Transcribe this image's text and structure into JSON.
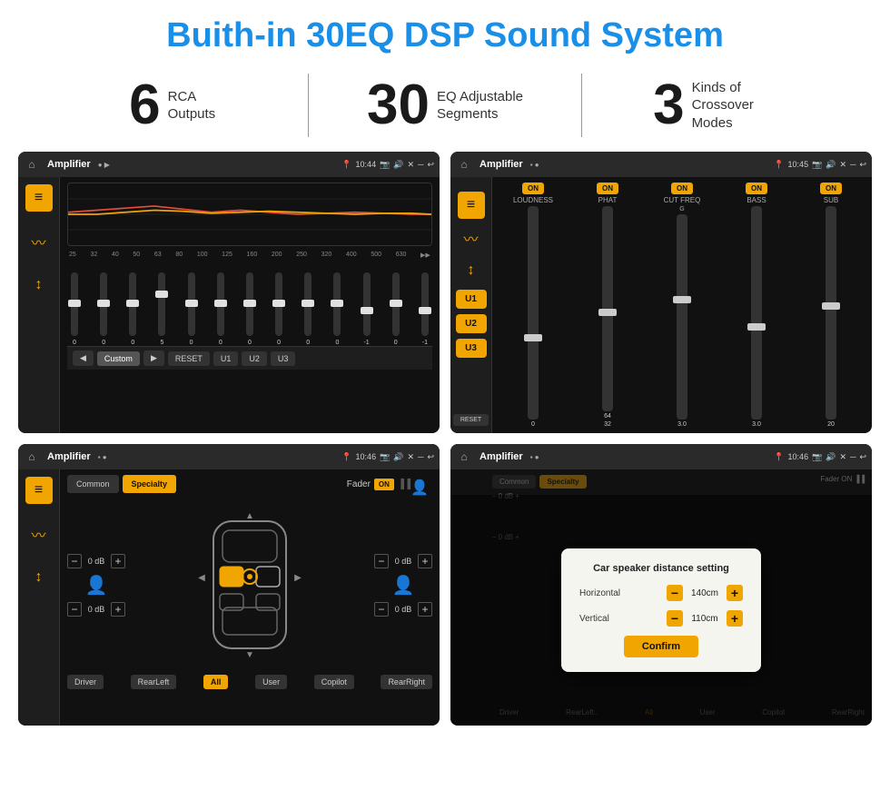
{
  "header": {
    "title": "Buith-in 30EQ DSP Sound System"
  },
  "stats": [
    {
      "number": "6",
      "label": "RCA\nOutputs"
    },
    {
      "number": "30",
      "label": "EQ Adjustable\nSegments"
    },
    {
      "number": "3",
      "label": "Kinds of\nCrossover Modes"
    }
  ],
  "screen1": {
    "title": "Amplifier",
    "time": "10:44",
    "freqs": [
      "25",
      "32",
      "40",
      "50",
      "63",
      "80",
      "100",
      "125",
      "160",
      "200",
      "250",
      "320",
      "400",
      "500",
      "630"
    ],
    "values": [
      "0",
      "0",
      "0",
      "5",
      "0",
      "0",
      "0",
      "0",
      "0",
      "0",
      "0",
      "-1",
      "0",
      "-1"
    ],
    "mode": "Custom",
    "buttons": [
      "RESET",
      "U1",
      "U2",
      "U3"
    ]
  },
  "screen2": {
    "title": "Amplifier",
    "time": "10:45",
    "u_buttons": [
      "U1",
      "U2",
      "U3"
    ],
    "channels": [
      {
        "label": "LOUDNESS",
        "on": true
      },
      {
        "label": "PHAT",
        "on": true
      },
      {
        "label": "CUT FREQ",
        "on": true
      },
      {
        "label": "BASS",
        "on": true
      },
      {
        "label": "SUB",
        "on": true
      }
    ],
    "reset_label": "RESET"
  },
  "screen3": {
    "title": "Amplifier",
    "time": "10:46",
    "tabs": [
      "Common",
      "Specialty"
    ],
    "fader_label": "Fader",
    "on_label": "ON",
    "db_values": [
      "0 dB",
      "0 dB",
      "0 dB",
      "0 dB"
    ],
    "bottom_buttons": [
      "Driver",
      "RearLeft",
      "All",
      "User",
      "Copilot",
      "RearRight"
    ]
  },
  "screen4": {
    "title": "Amplifier",
    "time": "10:46",
    "dialog": {
      "title": "Car speaker distance setting",
      "horizontal_label": "Horizontal",
      "horizontal_value": "140cm",
      "vertical_label": "Vertical",
      "vertical_value": "110cm",
      "confirm_label": "Confirm"
    },
    "bottom_buttons": [
      "Driver",
      "RearLeft..",
      "All",
      "User",
      "Copilot",
      "RearRight"
    ]
  },
  "icons": {
    "home": "⌂",
    "back": "↩",
    "pin": "📍",
    "camera": "📷",
    "volume": "🔊",
    "close": "✕",
    "minimize": "─",
    "eq_bars": "≡",
    "wave": "〰",
    "speaker": "📢"
  }
}
